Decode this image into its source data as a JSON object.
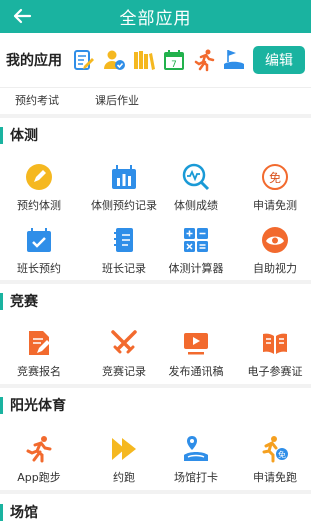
{
  "header": {
    "title": "全部应用"
  },
  "my_apps": {
    "label": "我的应用",
    "edit_label": "编辑"
  },
  "prev_row": [
    "预约考试",
    "课后作业"
  ],
  "sections": [
    {
      "title": "体测",
      "items": [
        "预约体测",
        "体侧预约记录",
        "体侧成绩",
        "申请免测",
        "班长预约",
        "班长记录",
        "体测计算器",
        "自助视力"
      ]
    },
    {
      "title": "竞赛",
      "items": [
        "竞赛报名",
        "竞赛记录",
        "发布通讯稿",
        "电子参赛证"
      ]
    },
    {
      "title": "阳光体育",
      "items": [
        "App跑步",
        "约跑",
        "场馆打卡",
        "申请免跑"
      ]
    },
    {
      "title": "场馆"
    }
  ],
  "badges": {
    "exempt_test": "免",
    "exempt_run": "免",
    "calendar_day": "7"
  },
  "colors": {
    "accent": "#1ab3a0",
    "orange": "#f26a2e",
    "blue": "#2f8ee8",
    "yellow": "#f5b820"
  }
}
